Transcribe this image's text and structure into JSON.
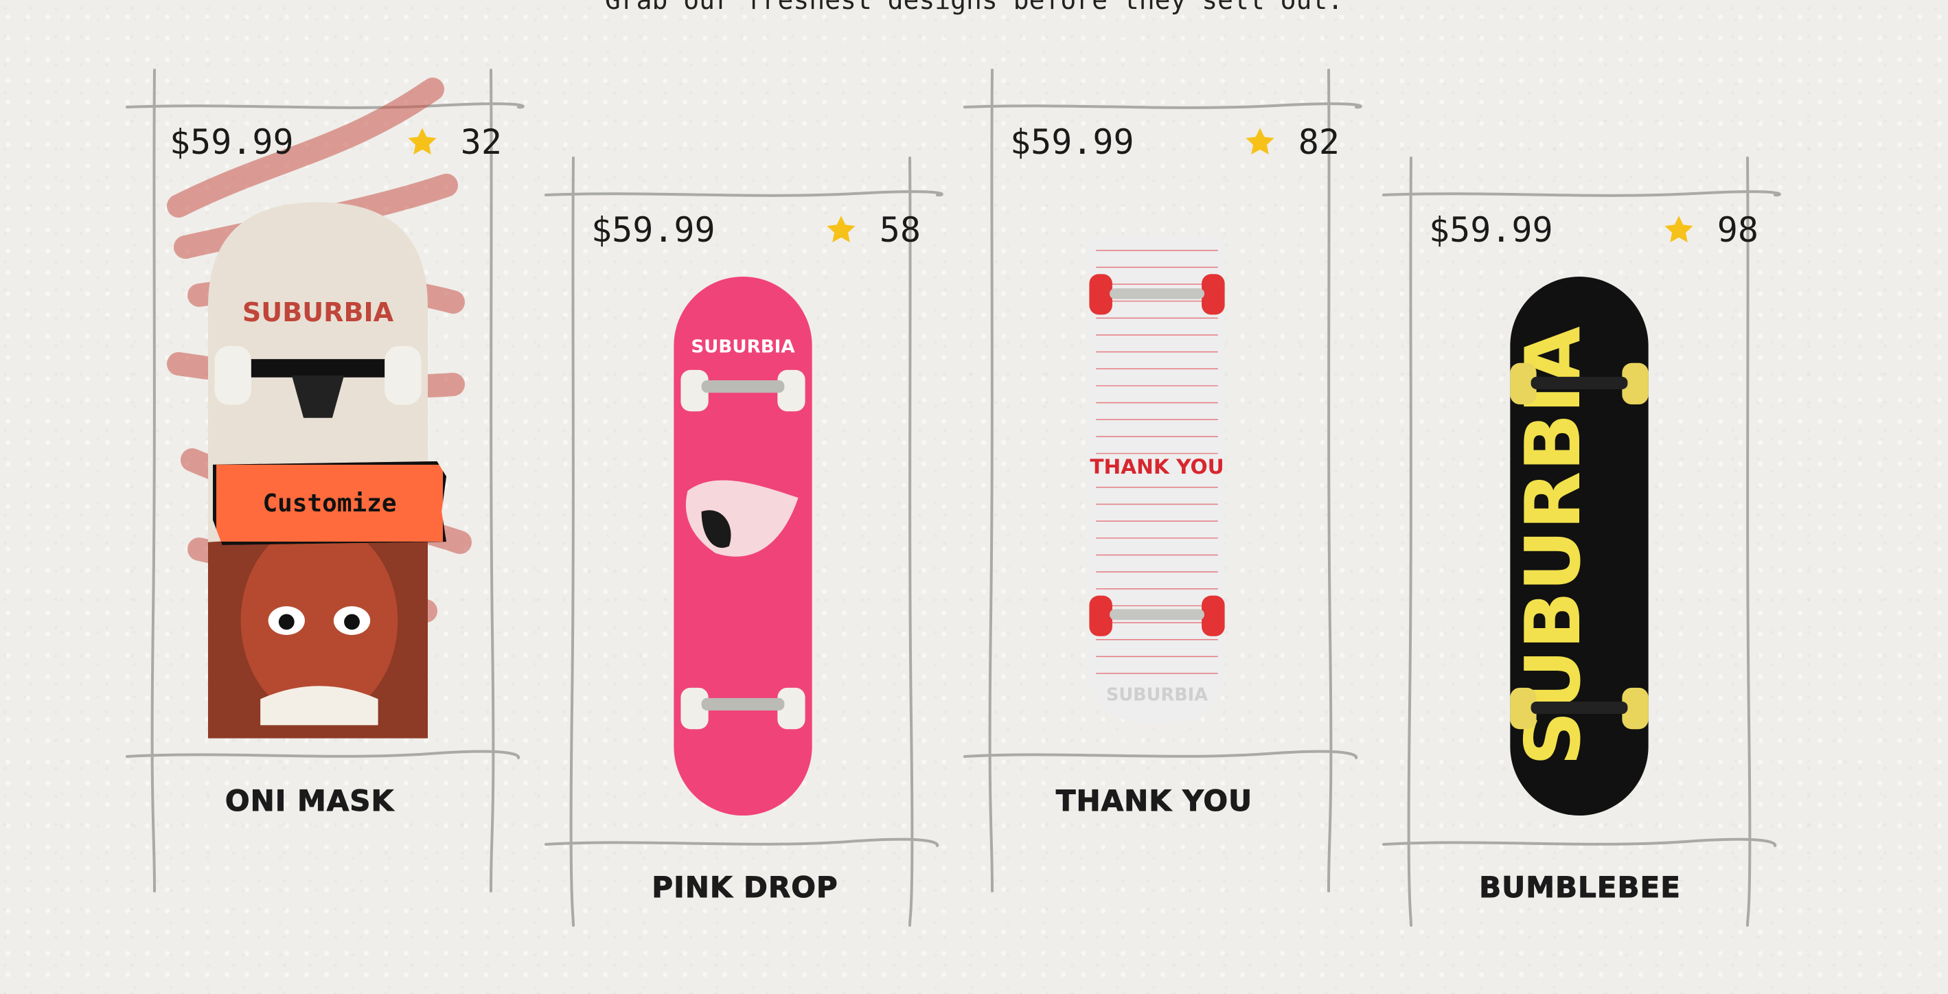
{
  "header": {
    "tagline": "Grab our freshest designs before they sell out."
  },
  "products": [
    {
      "name": "ONI MASK",
      "price": "$59.99",
      "rating": "32",
      "deck_brand": "SUBURBIA",
      "action_label": "Customize",
      "deck_color": "#e8e0d4",
      "accent": "#c0453a"
    },
    {
      "name": "PINK DROP",
      "price": "$59.99",
      "rating": "58",
      "deck_brand": "SUBURBIA",
      "deck_color": "#f0437a",
      "accent": "#ffffff"
    },
    {
      "name": "THANK YOU",
      "price": "$59.99",
      "rating": "82",
      "deck_brand": "SUBURBIA",
      "deck_text": "THANK YOU",
      "deck_color": "#eeeeee",
      "accent": "#d8262e"
    },
    {
      "name": "BUMBLEBEE",
      "price": "$59.99",
      "rating": "98",
      "deck_brand": "SUBURBIA",
      "deck_color": "#111111",
      "accent": "#f2e14c"
    }
  ],
  "icons": {
    "rating": "star-icon"
  },
  "colors": {
    "star": "#f6c21a",
    "button": "#ff6b3d",
    "frame": "#a9a9a5"
  }
}
